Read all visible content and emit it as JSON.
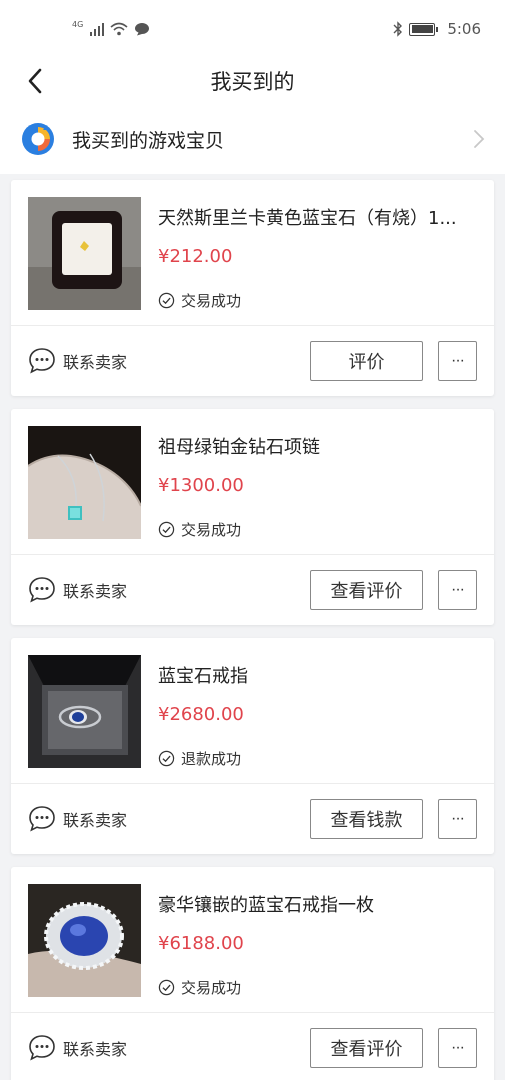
{
  "status_bar": {
    "network": "4G",
    "time": "5:06"
  },
  "nav": {
    "title": "我买到的"
  },
  "game_banner": {
    "label": "我买到的游戏宝贝"
  },
  "orders": [
    {
      "title": "天然斯里兰卡黄色蓝宝石（有烧）1...",
      "price": "¥212.00",
      "status": "交易成功",
      "contact_label": "联系卖家",
      "action_label": "评价",
      "more_label": "···"
    },
    {
      "title": "祖母绿铂金钻石项链",
      "price": "¥1300.00",
      "status": "交易成功",
      "contact_label": "联系卖家",
      "action_label": "查看评价",
      "more_label": "···"
    },
    {
      "title": "蓝宝石戒指",
      "price": "¥2680.00",
      "status": "退款成功",
      "contact_label": "联系卖家",
      "action_label": "查看钱款",
      "more_label": "···"
    },
    {
      "title": "豪华镶嵌的蓝宝石戒指一枚",
      "price": "¥6188.00",
      "status": "交易成功",
      "contact_label": "联系卖家",
      "action_label": "查看评价",
      "more_label": "···"
    }
  ],
  "colors": {
    "price": "#e0444c",
    "background": "#f2f3f5"
  }
}
